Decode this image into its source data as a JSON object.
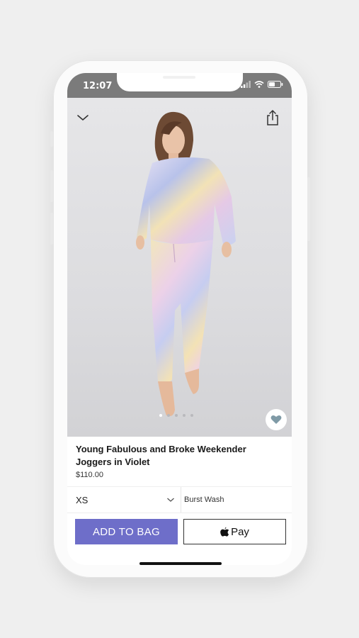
{
  "status_bar": {
    "time": "12:07"
  },
  "nav": {
    "collapse_icon": "chevron-down-icon",
    "share_icon": "share-icon"
  },
  "gallery": {
    "image_count": 5,
    "active_index": 0,
    "favorite_icon": "heart-icon"
  },
  "product": {
    "title": "Young Fabulous and Broke Weekender Joggers in Violet",
    "price": "$110.00"
  },
  "options": {
    "size": "XS",
    "color": "Burst Wash"
  },
  "actions": {
    "add_to_bag": "ADD TO BAG",
    "apple_pay": "Pay"
  },
  "colors": {
    "accent": "#6e6ec9",
    "status_bar": "#7b7b7b",
    "heart": "#7f9aa6"
  }
}
